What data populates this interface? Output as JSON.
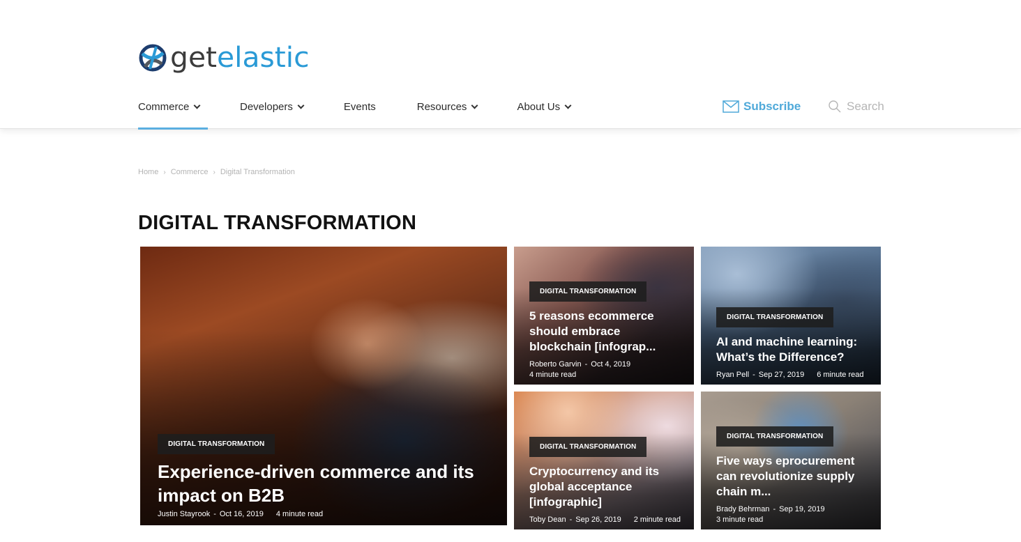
{
  "brand": {
    "logo_part1": "get",
    "logo_part2": "elastic",
    "accent_color": "#2a9ad6"
  },
  "nav": {
    "items": [
      {
        "label": "Commerce",
        "has_dropdown": true,
        "active": true
      },
      {
        "label": "Developers",
        "has_dropdown": true,
        "active": false
      },
      {
        "label": "Events",
        "has_dropdown": false,
        "active": false
      },
      {
        "label": "Resources",
        "has_dropdown": true,
        "active": false
      },
      {
        "label": "About Us",
        "has_dropdown": true,
        "active": false
      }
    ],
    "subscribe_label": "Subscribe",
    "subscribe_icon": "envelope-icon",
    "search_label": "Search",
    "search_icon": "magnifier-icon"
  },
  "breadcrumb": {
    "items": [
      "Home",
      "Commerce",
      "Digital Transformation"
    ],
    "separator": "›"
  },
  "page": {
    "title": "DIGITAL TRANSFORMATION"
  },
  "articles": [
    {
      "category": "DIGITAL TRANSFORMATION",
      "title": "Experience-driven commerce and its impact on B2B",
      "author": "Justin Stayrook",
      "date": "Oct 16, 2019",
      "read_time": "4 minute read"
    },
    {
      "category": "DIGITAL TRANSFORMATION",
      "title": "5 reasons ecommerce should embrace blockchain [infograp...",
      "author": "Roberto Garvin",
      "date": "Oct 4, 2019",
      "read_time": "4 minute read"
    },
    {
      "category": "DIGITAL TRANSFORMATION",
      "title": "AI and machine learning: What’s the Difference?",
      "author": "Ryan Pell",
      "date": "Sep 27, 2019",
      "read_time": "6 minute read"
    },
    {
      "category": "DIGITAL TRANSFORMATION",
      "title": "Cryptocurrency and its global acceptance [infographic]",
      "author": "Toby Dean",
      "date": "Sep 26, 2019",
      "read_time": "2 minute read"
    },
    {
      "category": "DIGITAL TRANSFORMATION",
      "title": "Five ways eprocurement can revolutionize supply chain m...",
      "author": "Brady Behrman",
      "date": "Sep 19, 2019",
      "read_time": "3 minute read"
    }
  ],
  "meta_separator": "-"
}
